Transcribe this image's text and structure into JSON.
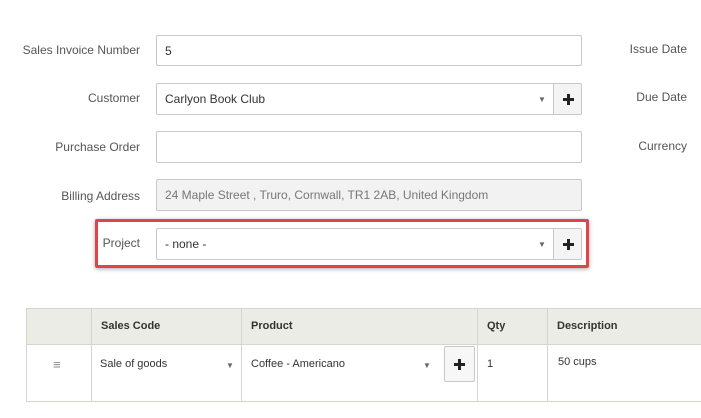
{
  "form": {
    "invoice_number": {
      "label": "Sales Invoice Number",
      "value": "5"
    },
    "customer": {
      "label": "Customer",
      "value": "Carlyon Book Club"
    },
    "purchase_order": {
      "label": "Purchase Order",
      "value": ""
    },
    "billing_address": {
      "label": "Billing Address",
      "value": "24 Maple Street , Truro, Cornwall, TR1 2AB, United Kingdom"
    },
    "project": {
      "label": "Project",
      "value": "- none -"
    }
  },
  "side_labels": {
    "issue_date": "Issue Date",
    "due_date": "Due Date",
    "currency": "Currency"
  },
  "icons": {
    "add": "plus-icon",
    "dropdown": "caret-down-icon",
    "drag": "drag-handle-icon"
  },
  "colors": {
    "highlight": "#e0444a",
    "table_header_bg": "#ecece7",
    "readonly_bg": "#f2f2f2"
  },
  "table": {
    "columns": [
      "Sales Code",
      "Product",
      "Qty",
      "Description"
    ],
    "rows": [
      {
        "handle": "≡",
        "sales_code": "Sale of goods",
        "product": "Coffee - Americano",
        "qty": "1",
        "description": "50 cups"
      }
    ]
  }
}
